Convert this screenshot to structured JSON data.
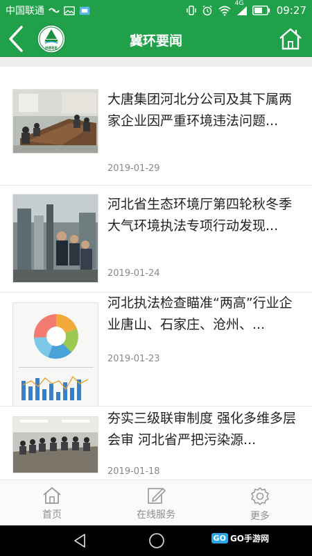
{
  "status_bar": {
    "carrier": "中国联通",
    "network": "4G",
    "time": "09:27"
  },
  "header": {
    "title": "冀环要闻",
    "logo_text": "HBEE"
  },
  "news": [
    {
      "title": "大唐集团河北分公司及其下属两家企业因严重环境违法问题...",
      "date": "2019-01-29",
      "thumb_icon": "meeting-room-photo"
    },
    {
      "title": "河北省生态环境厅第四轮秋冬季大气环境执法专项行动发现...",
      "date": "2019-01-24",
      "thumb_icon": "factory-inspection-photo"
    },
    {
      "title": "河北执法检查瞄准“两高”行业企业唐山、石家庄、沧州、...",
      "date": "2019-01-23",
      "thumb_icon": "statistics-chart-image"
    },
    {
      "title": "夯实三级联审制度 强化多维多层会审 河北省严把污染源...",
      "date": "2019-01-18",
      "thumb_icon": "conference-photo"
    }
  ],
  "bottom_nav": [
    {
      "label": "首页",
      "icon": "home-icon"
    },
    {
      "label": "在线服务",
      "icon": "edit-icon"
    },
    {
      "label": "更多",
      "icon": "gear-icon"
    }
  ],
  "watermark": {
    "badge": "GO",
    "text": "GO手游网"
  },
  "colors": {
    "brand_green": "#21a04a",
    "nav_gray": "#8e8e8e",
    "date_gray": "#888888"
  }
}
